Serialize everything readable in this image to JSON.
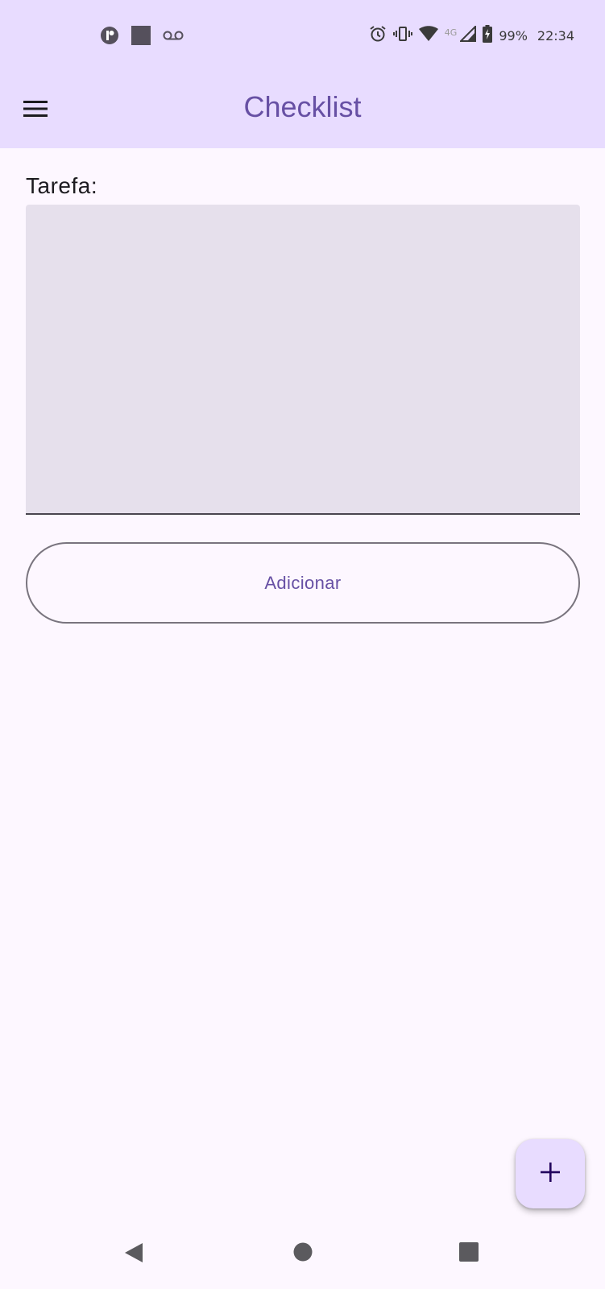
{
  "status_bar": {
    "time": "22:34",
    "battery": "99%",
    "network": "4G",
    "left_icons": [
      "app-notification-icon",
      "stop-square-icon",
      "voicemail-icon"
    ],
    "right_icons": [
      "alarm-icon",
      "vibrate-icon",
      "wifi-icon",
      "cell-signal-icon",
      "battery-charging-icon"
    ]
  },
  "app_bar": {
    "title": "Checklist",
    "menu_icon": "hamburger-menu-icon"
  },
  "form": {
    "label": "Tarefa:",
    "task_value": "",
    "add_button_label": "Adicionar"
  },
  "fab": {
    "icon": "plus-icon"
  },
  "nav_bar": {
    "icons": [
      "back-icon",
      "home-icon",
      "recents-icon"
    ]
  },
  "colors": {
    "primary": "#6750a4",
    "app_bar_bg": "#e8dcff",
    "surface": "#fdf7ff",
    "field_bg": "#e6e0ec",
    "outline": "#79747e"
  }
}
